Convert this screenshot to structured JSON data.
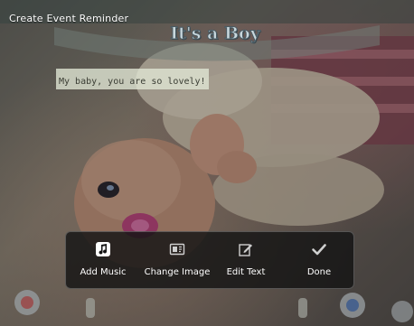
{
  "screen": {
    "title": "Create Event Reminder"
  },
  "frame": {
    "banner_text": "It's a Boy",
    "caption": "My baby, you are so lovely!"
  },
  "toolbar": {
    "items": [
      {
        "label": "Add Music",
        "icon": "music-note-icon"
      },
      {
        "label": "Change Image",
        "icon": "change-image-icon"
      },
      {
        "label": "Edit Text",
        "icon": "edit-text-icon"
      },
      {
        "label": "Done",
        "icon": "checkmark-icon"
      }
    ]
  },
  "colors": {
    "toolbar_background": "#141414",
    "label_text": "#ffffff",
    "caption_background": "#e1e8d6"
  }
}
